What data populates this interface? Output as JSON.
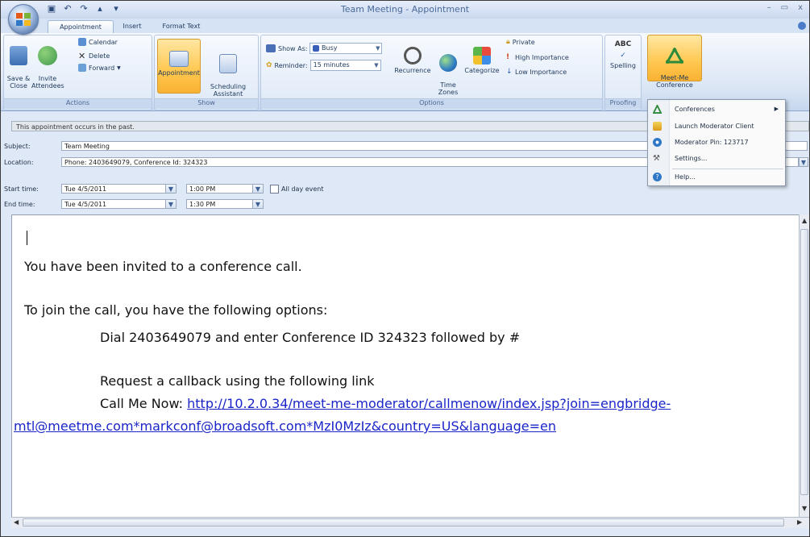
{
  "window": {
    "title": "Team Meeting - Appointment",
    "minimize_glyph": "–",
    "restore_glyph": "▭",
    "close_glyph": "x"
  },
  "tabs": [
    "Appointment",
    "Insert",
    "Format Text"
  ],
  "ribbon": {
    "actions": {
      "label": "Actions",
      "save_close": "Save &\nClose",
      "invite_attendees": "Invite\nAttendees",
      "calendar": "Calendar",
      "delete": "Delete",
      "forward": "Forward"
    },
    "show": {
      "label": "Show",
      "appointment": "Appointment",
      "scheduling_assistant": "Scheduling\nAssistant"
    },
    "options": {
      "label": "Options",
      "show_as_label": "Show As:",
      "show_as_value": "Busy",
      "reminder_label": "Reminder:",
      "reminder_value": "15 minutes",
      "recurrence": "Recurrence",
      "time_zones": "Time\nZones",
      "categorize": "Categorize",
      "private": "Private",
      "high_importance": "High Importance",
      "low_importance": "Low Importance"
    },
    "proofing": {
      "label": "Proofing",
      "spelling": "Spelling"
    },
    "meetme": {
      "label": "Meet-Me\nConference"
    }
  },
  "infobar": "This appointment occurs in the past.",
  "form": {
    "subject_label": "Subject:",
    "subject_value": "Team Meeting",
    "location_label": "Location:",
    "location_value": "Phone: 2403649079, Conference Id: 324323",
    "start_label": "Start time:",
    "start_date": "Tue 4/5/2011",
    "start_time": "1:00 PM",
    "end_label": "End time:",
    "end_date": "Tue 4/5/2011",
    "end_time": "1:30 PM",
    "all_day_label": "All day event"
  },
  "body": {
    "line1": "You have been invited to a conference call.",
    "line2": "To join the call, you have the following options:",
    "line3": "Dial 2403649079 and enter Conference ID 324323 followed by #",
    "line4": "Request a callback using the following link",
    "line5_prefix": "Call Me Now: ",
    "link_part1": "http://10.2.0.34/meet-me-moderator/callmenow/index.jsp?join=engbridge-",
    "link_part2": "mtl@meetme.com*markconf@broadsoft.com*MzI0MzIz&country=US&language=en"
  },
  "menu": {
    "items": [
      "Conferences",
      "Launch Moderator Client",
      "Moderator Pin: 123717",
      "Settings...",
      "Help..."
    ]
  },
  "colors": {
    "ribbon_blue": "#dbe6f5",
    "pressed_orange": "#ffc74f",
    "link_blue": "#1a25c8"
  }
}
